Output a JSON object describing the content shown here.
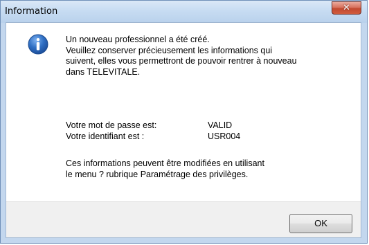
{
  "window": {
    "title": "Information",
    "close_icon": "close-icon"
  },
  "dialog": {
    "icon": "info-icon",
    "message_lines": [
      "Un nouveau professionnel a été créé.",
      "Veuillez conserver précieusement les informations qui",
      "suivent, elles vous permettront de pouvoir rentrer à nouveau",
      "dans TELEVITALE."
    ],
    "password_label": "Votre mot de passe est:",
    "password_value": "VALID",
    "id_label": "Votre identifiant est :",
    "id_value": "USR004",
    "note_lines": [
      "Ces informations peuvent être modifiées en utilisant",
      "le menu ? rubrique Paramétrage des privilèges."
    ]
  },
  "buttons": {
    "ok_label": "OK"
  },
  "colors": {
    "titlebar": "#c7dcf2",
    "close_button": "#c24a31",
    "info_icon": "#2f6fc4",
    "footer": "#f0f0f0"
  }
}
